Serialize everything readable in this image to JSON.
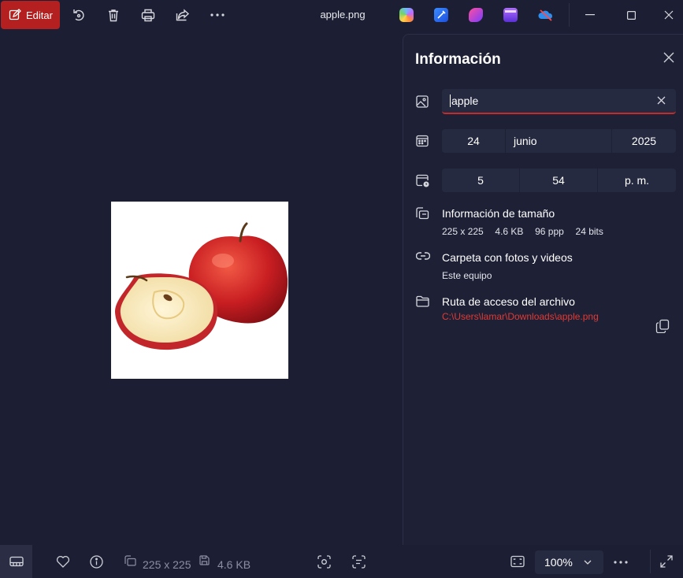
{
  "toolbar": {
    "edit_label": "Editar",
    "icons": [
      "rotate-icon",
      "delete-icon",
      "print-icon",
      "share-icon",
      "more-icon"
    ]
  },
  "window": {
    "title": "apple.png"
  },
  "app_icons": [
    "copilot-icon",
    "designer-icon",
    "clipchamp-icon",
    "video-editor-icon",
    "onedrive-icon"
  ],
  "info_panel": {
    "title": "Información",
    "name_value": "apple",
    "date": {
      "day": "24",
      "month": "junio",
      "year": "2025"
    },
    "time": {
      "hour": "5",
      "minute": "54",
      "period": "p. m."
    },
    "size_heading": "Información de tamaño",
    "dimensions": "225 x 225",
    "file_size": "4.6 KB",
    "dpi": "96 ppp",
    "bit_depth": "24 bits",
    "folder_heading": "Carpeta con fotos y videos",
    "folder_value": "Este equipo",
    "path_heading": "Ruta de acceso del archivo",
    "path_value": "C:\\Users\\lamar\\Downloads\\apple.png"
  },
  "bottom_bar": {
    "dimensions": "225 x 225",
    "file_size": "4.6 KB",
    "zoom": "100%"
  },
  "colors": {
    "accent": "#b3201f",
    "background": "#1c1f33",
    "panel": "#1e2136",
    "link": "#e03a34"
  }
}
